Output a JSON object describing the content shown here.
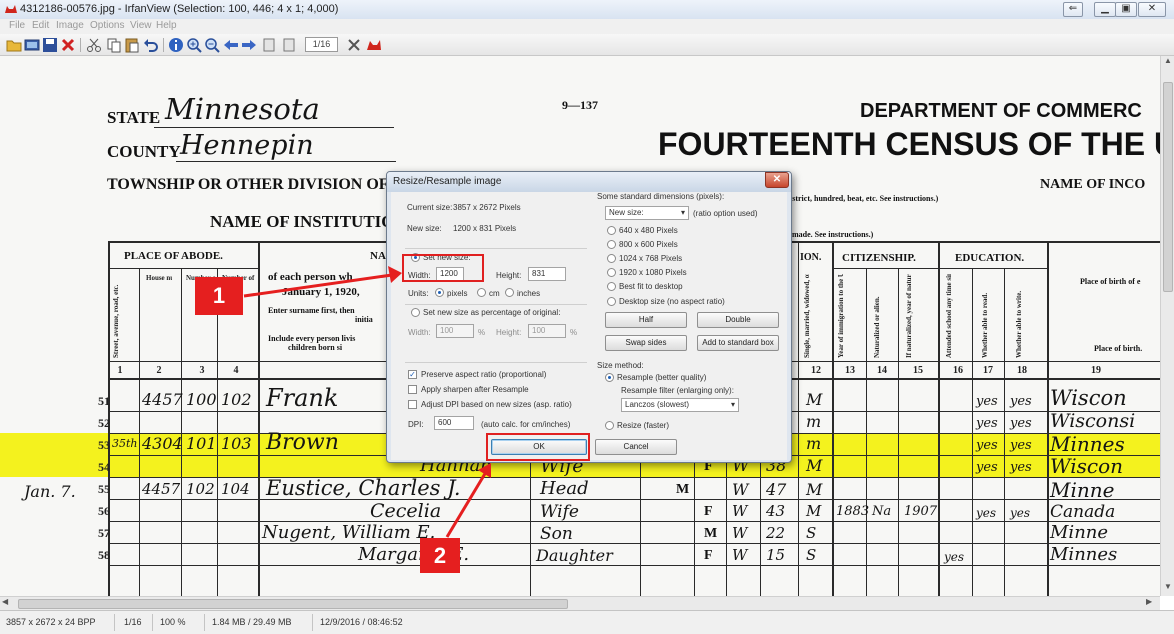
{
  "window": {
    "title": "4312186-00576.jpg - IrfanView (Selection: 100, 446; 4 x 1; 4,000)",
    "icon": "irfanview-cat-icon",
    "controls": [
      "back-icon",
      "minimize-icon",
      "maximize-icon",
      "close-icon"
    ]
  },
  "menu": {
    "items": [
      "File",
      "Edit",
      "Image",
      "Options",
      "View",
      "Help"
    ]
  },
  "toolbar": {
    "icons": [
      "open-folder-icon",
      "slideshow-icon",
      "save-icon",
      "delete-icon",
      "cut-icon",
      "copy-icon",
      "paste-icon",
      "undo-icon",
      "info-icon",
      "zoom-in-icon",
      "zoom-out-icon",
      "previous-icon",
      "next-icon",
      "first-page-icon",
      "last-page-icon",
      "settings-icon",
      "cat-icon"
    ],
    "page_indicator": "1/16"
  },
  "document": {
    "page_code": "9—137",
    "state_label": "STATE",
    "state_value": "Minnesota",
    "county_label": "COUNTY",
    "county_value": "Hennepin",
    "township_label": "TOWNSHIP OR OTHER DIVISION OF",
    "institution_label": "NAME OF INSTITUTION",
    "dept_header": "DEPARTMENT OF COMMERC",
    "census_header": "FOURTEENTH CENSUS OF THE U",
    "name_of_inco": "NAME OF INCO",
    "district_note": "istrict, hundred, beat, etc. See instructions.)",
    "made_note": "made. See instructions.)",
    "place_of_abode": "PLACE OF ABODE.",
    "na_fragment": "NA",
    "person_note_1": "of each person wh",
    "person_note_2": "January 1, 1920,",
    "person_note_3": "Enter surname first, then",
    "person_note_4": "initia",
    "person_note_5": "Include every person livis",
    "person_note_6": "children born si",
    "col_heads": [
      "Street, avenue, road, etc.",
      "House number or farm, etc. (See instructions.)",
      "Number of dwelling house in order of visitation.",
      "Number of family in order of visitation."
    ],
    "citizenship": "CITIZENSHIP.",
    "education": "EDUCATION.",
    "ion": "ION.",
    "citizenship_heads": [
      "Year of immigration to the United States.",
      "Naturalized or alien.",
      "If naturalized, year of naturalization."
    ],
    "education_heads": [
      "Attended school any time since Sept. 1, 1919.",
      "Whether able to read.",
      "Whether able to write."
    ],
    "marital_head": "Single, married, widowed, or divorced.",
    "birth_head_1": "Place of birth of e",
    "birth_head_2": "Place of birth.",
    "col_numbers": [
      "1",
      "2",
      "3",
      "4",
      "12",
      "13",
      "14",
      "15",
      "16",
      "17",
      "18",
      "19"
    ],
    "row_numbers": [
      "51",
      "52",
      "53",
      "54",
      "55",
      "56",
      "57",
      "58"
    ],
    "entries": {
      "r51_house": "4457",
      "r51_dwelling": "100",
      "r51_family": "102",
      "r51_name": "Frank",
      "r51_status": "M",
      "r51_read": "yes",
      "r51_write": "yes",
      "r51_birth": "Wiscon",
      "r52_status": "m",
      "r52_read": "yes",
      "r52_write": "yes",
      "r52_birth": "Wisconsi",
      "r53_street": "35th",
      "r53_house": "4304",
      "r53_dwelling": "101",
      "r53_family": "103",
      "r53_name": "Brown",
      "r53_status": "m",
      "r53_read": "yes",
      "r53_write": "yes",
      "r53_birth": "Minnes",
      "r54_name": "Hannah",
      "r54_rel": "Wife",
      "r54_sex": "F",
      "r54_race": "W",
      "r54_age": "38",
      "r54_status": "M",
      "r54_read": "yes",
      "r54_write": "yes",
      "r54_birth": "Wiscon",
      "r55_margin": "Jan. 7.",
      "r55_house": "4457",
      "r55_dwelling": "102",
      "r55_family": "104",
      "r55_name": "Eustice, Charles J.",
      "r55_rel": "Head",
      "r55_sex": "M",
      "r55_race": "W",
      "r55_age": "47",
      "r55_status": "M",
      "r55_birth": "Minne",
      "r56_name": "Cecelia",
      "r56_rel": "Wife",
      "r56_sex": "F",
      "r56_race": "W",
      "r56_age": "43",
      "r56_status": "M",
      "r56_immig": "1883",
      "r56_nat": "Na",
      "r56_natyr": "1907",
      "r56_read": "yes",
      "r56_write": "yes",
      "r56_birth": "Canada",
      "r57_name": "Nugent, William E.",
      "r57_rel": "Son",
      "r57_sex": "M",
      "r57_race": "W",
      "r57_age": "22",
      "r57_status": "S",
      "r57_birth": "Minne",
      "r58_name": "Margaret E.",
      "r58_rel": "Daughter",
      "r58_sex": "F",
      "r58_race": "W",
      "r58_age": "15",
      "r58_status": "S",
      "r58_school": "yes",
      "r58_birth": "Minnes"
    }
  },
  "dialog": {
    "title": "Resize/Resample image",
    "current_size_label": "Current size:",
    "current_size_value": "3857 x 2672  Pixels",
    "new_size_label": "New size:",
    "new_size_value": "1200 x 831  Pixels",
    "set_new_size": "Set new size:",
    "width_label": "Width:",
    "width_value": "1200",
    "height_label": "Height:",
    "height_value": "831",
    "units_label": "Units:",
    "unit_pixels": "pixels",
    "unit_cm": "cm",
    "unit_inches": "inches",
    "set_percentage": "Set new size as percentage of original:",
    "pct_width_label": "Width:",
    "pct_width_value": "100",
    "pct_height_label": "Height:",
    "pct_height_value": "100",
    "pct_sign": "%",
    "preserve_aspect": "Preserve aspect ratio (proportional)",
    "apply_sharpen": "Apply sharpen after Resample",
    "adjust_dpi": "Adjust DPI based on new sizes (asp. ratio)",
    "dpi_label": "DPI:",
    "dpi_value": "600",
    "dpi_note": "(auto calc. for cm/inches)",
    "standard_label": "Some standard dimensions (pixels):",
    "standard_select": "New size:",
    "ratio_note": "(ratio option used)",
    "presets": [
      "640 x 480 Pixels",
      "800 x 600 Pixels",
      "1024 x 768 Pixels",
      "1920 x 1080 Pixels",
      "Best fit to desktop",
      "Desktop size (no aspect ratio)"
    ],
    "half": "Half",
    "double": "Double",
    "swap_sides": "Swap sides",
    "add_standard": "Add to standard box",
    "size_method": "Size method:",
    "resample": "Resample (better quality)",
    "resample_filter": "Resample filter (enlarging only):",
    "filter_value": "Lanczos (slowest)",
    "resize_faster": "Resize (faster)",
    "ok": "OK",
    "cancel": "Cancel"
  },
  "annotations": {
    "step1": "1",
    "step2": "2",
    "color": "#e51f1f"
  },
  "status": {
    "dims": "3857 x 2672 x 24 BPP",
    "page": "1/16",
    "zoom": "100 %",
    "size": "1.84 MB / 29.49 MB",
    "datetime": "12/9/2016 / 08:46:52"
  },
  "colors": {
    "highlight": "#f4f21e",
    "annotation_red": "#e51f1f",
    "dialog_frame": "#dfe6ef"
  }
}
